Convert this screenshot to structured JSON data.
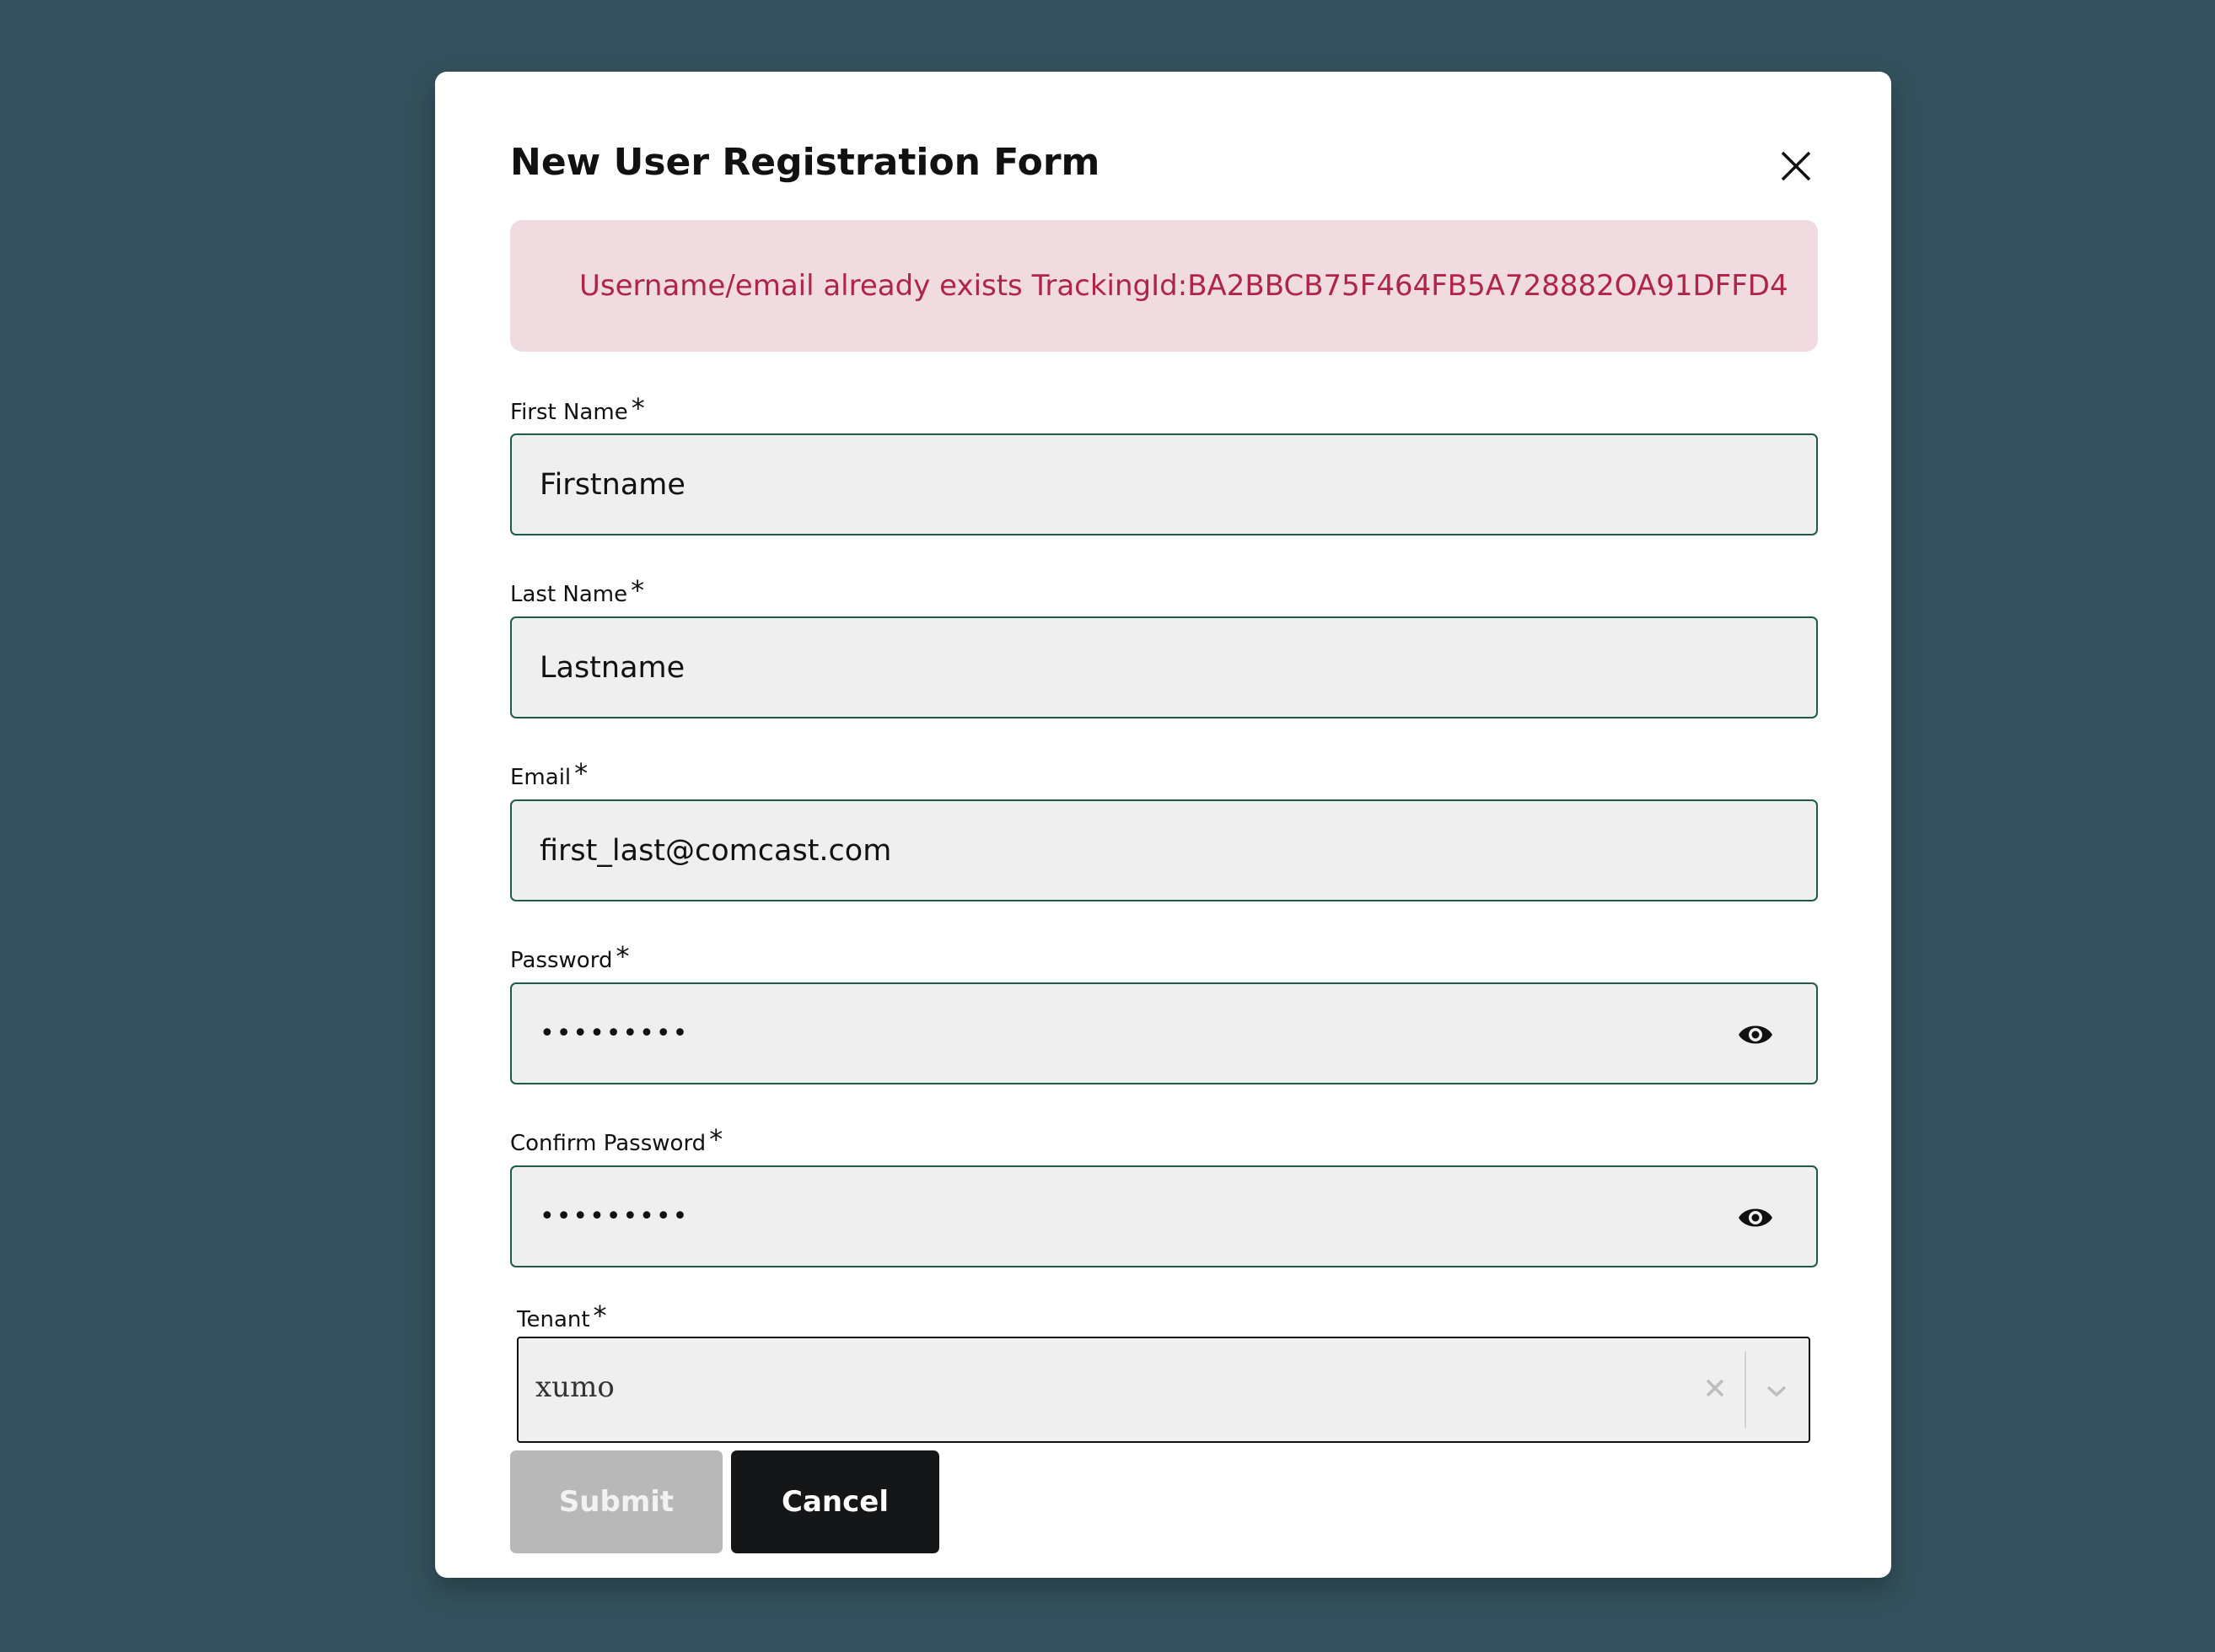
{
  "modal": {
    "title": "New User Registration Form",
    "error_message": "Username/email already exists TrackingId:BA2BBCB75F464FB5A728882OA91DFFD4"
  },
  "fields": {
    "first_name": {
      "label": "First Name",
      "required_mark": "*",
      "value": "Firstname"
    },
    "last_name": {
      "label": "Last Name",
      "required_mark": "*",
      "value": "Lastname"
    },
    "email": {
      "label": "Email",
      "required_mark": "*",
      "value": "first_last@comcast.com"
    },
    "password": {
      "label": "Password",
      "required_mark": "*",
      "value": "•••••••••"
    },
    "confirm_password": {
      "label": "Confirm Password",
      "required_mark": "*",
      "value": "•••••••••"
    },
    "tenant": {
      "label": "Tenant",
      "required_mark": "*",
      "value": "xumo"
    }
  },
  "buttons": {
    "submit": "Submit",
    "cancel": "Cancel"
  },
  "icons": {
    "close": "close-icon",
    "eye": "eye-icon",
    "clear": "clear-icon",
    "chevron": "chevron-down-icon"
  },
  "colors": {
    "backdrop": "#33515c",
    "field_border": "#1e5c46",
    "error_bg": "#efdbe0",
    "error_text": "#b02448",
    "submit_disabled": "#b8b8b8",
    "cancel_bg": "#151618"
  }
}
